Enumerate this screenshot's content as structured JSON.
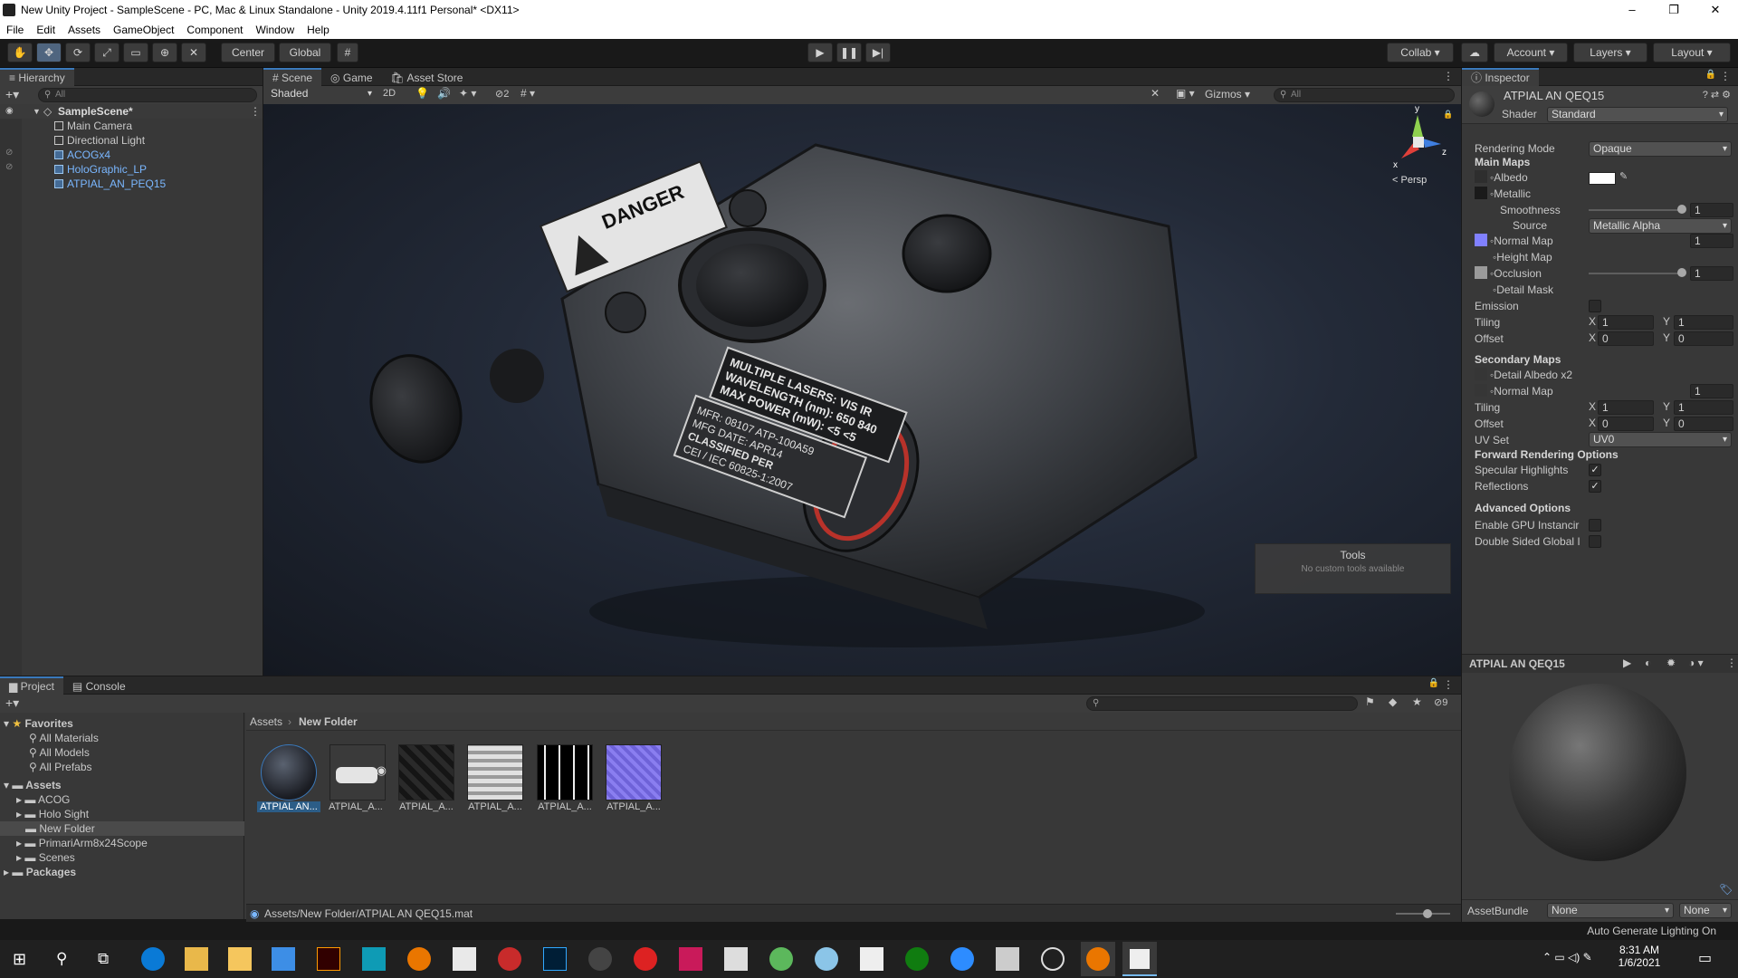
{
  "window": {
    "title": "New Unity Project - SampleScene - PC, Mac & Linux Standalone - Unity 2019.4.11f1 Personal* <DX11>"
  },
  "menu": [
    "File",
    "Edit",
    "Assets",
    "GameObject",
    "Component",
    "Window",
    "Help"
  ],
  "toolbar": {
    "pivot": "Center",
    "space": "Global",
    "collab": "Collab",
    "account": "Account",
    "layers": "Layers",
    "layout": "Layout"
  },
  "hierarchy": {
    "tab": "Hierarchy",
    "search_placeholder": "All",
    "scene": "SampleScene*",
    "items": [
      {
        "label": "Main Camera",
        "type": "white"
      },
      {
        "label": "Directional Light",
        "type": "white"
      },
      {
        "label": "ACOGx4",
        "type": "prefab"
      },
      {
        "label": "HoloGraphic_LP",
        "type": "prefab"
      },
      {
        "label": "ATPIAL_AN_PEQ15",
        "type": "prefab"
      }
    ]
  },
  "scene": {
    "tabs": [
      "Scene",
      "Game",
      "Asset Store"
    ],
    "shading": "Shaded",
    "mode2d": "2D",
    "hidden_count": "2",
    "gizmos": "Gizmos",
    "search_placeholder": "All",
    "persp": "Persp",
    "axis_x": "x",
    "axis_y": "y",
    "axis_z": "z",
    "tools_title": "Tools",
    "tools_msg": "No custom tools available",
    "decal": {
      "danger": "DANGER",
      "l1": "MULTIPLE LASERS: VIS IR",
      "l2": "WAVELENGTH (nm): 650 840",
      "l3": "MAX POWER (mW): <5 <5",
      "l4": "MFR: 08107   ATP-100A59",
      "l5": "MFG DATE: APR14",
      "l6": "CLASSIFIED PER",
      "l7": "CEI / IEC 60825-1:2007"
    }
  },
  "inspector": {
    "tab": "Inspector",
    "material": "ATPIAL AN QEQ15",
    "shader_label": "Shader",
    "shader": "Standard",
    "rendering_mode_label": "Rendering Mode",
    "rendering_mode": "Opaque",
    "main_maps": "Main Maps",
    "albedo": "Albedo",
    "metallic": "Metallic",
    "smoothness": "Smoothness",
    "smoothness_val": "1",
    "source": "Source",
    "source_val": "Metallic Alpha",
    "normal_map": "Normal Map",
    "normal_val": "1",
    "height_map": "Height Map",
    "occlusion": "Occlusion",
    "occlusion_val": "1",
    "detail_mask": "Detail Mask",
    "emission": "Emission",
    "tiling": "Tiling",
    "offset": "Offset",
    "x": "X",
    "y": "Y",
    "tiling_x": "1",
    "tiling_y": "1",
    "offset_x": "0",
    "offset_y": "0",
    "secondary_maps": "Secondary Maps",
    "detail_albedo": "Detail Albedo x2",
    "sec_normal": "Normal Map",
    "sec_normal_val": "1",
    "sec_tiling_x": "1",
    "sec_tiling_y": "1",
    "sec_offset_x": "0",
    "sec_offset_y": "0",
    "uv_set": "UV Set",
    "uv_val": "UV0",
    "forward": "Forward Rendering Options",
    "specular": "Specular Highlights",
    "reflections": "Reflections",
    "advanced": "Advanced Options",
    "gpu": "Enable GPU Instancir",
    "double_sided": "Double Sided Global I",
    "preview_title": "ATPIAL AN QEQ15",
    "assetbundle": "AssetBundle",
    "ab_none1": "None",
    "ab_none2": "None"
  },
  "project": {
    "tabs": [
      "Project",
      "Console"
    ],
    "favorites": "Favorites",
    "fav_items": [
      "All Materials",
      "All Models",
      "All Prefabs"
    ],
    "assets": "Assets",
    "asset_folders": [
      "ACOG",
      "Holo Sight",
      "New Folder",
      "PrimariArm8x24Scope",
      "Scenes"
    ],
    "packages": "Packages",
    "breadcrumb_root": "Assets",
    "breadcrumb_leaf": "New Folder",
    "hidden_count": "9",
    "files": [
      "ATPIAL AN...",
      "ATPIAL_A...",
      "ATPIAL_A...",
      "ATPIAL_A...",
      "ATPIAL_A...",
      "ATPIAL_A..."
    ],
    "status_path": "Assets/New Folder/ATPIAL AN QEQ15.mat",
    "auto_lighting": "Auto Generate Lighting On"
  },
  "taskbar": {
    "time": "8:31 AM",
    "date": "1/6/2021"
  },
  "colors": {
    "accent": "#3a79bb",
    "selection": "#2c5d87",
    "panel": "#383838",
    "dark": "#191919"
  }
}
